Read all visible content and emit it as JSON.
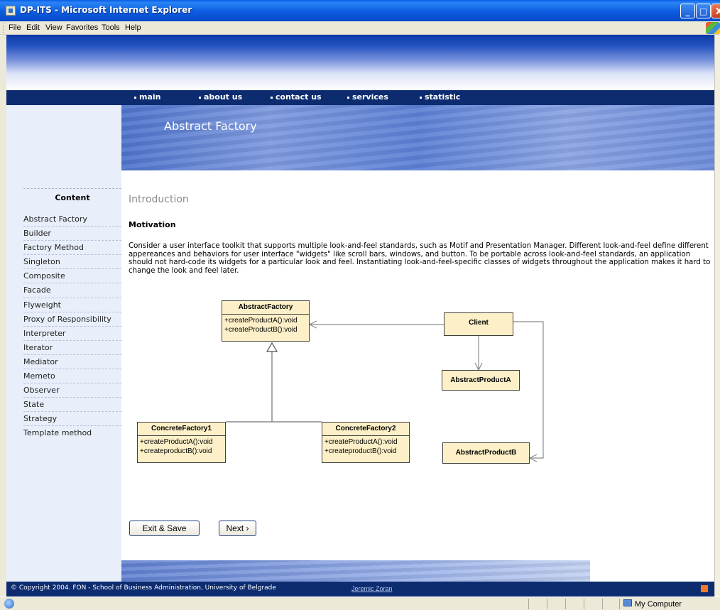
{
  "window": {
    "title": "DP-ITS - Microsoft Internet Explorer",
    "minimize": "_",
    "maximize": "□",
    "close": "X"
  },
  "menu": [
    "File",
    "Edit",
    "View",
    "Favorites",
    "Tools",
    "Help"
  ],
  "nav": [
    "main",
    "about us",
    "contact us",
    "services",
    "statistic"
  ],
  "banner": {
    "title": "Abstract Factory"
  },
  "sidebar": {
    "heading": "Content",
    "items": [
      "Abstract Factory",
      "Builder",
      "Factory Method",
      "Singleton",
      "Composite",
      "Facade",
      "Flyweight",
      "Proxy of Responsibility",
      "Interpreter",
      "Iterator",
      "Mediator",
      "Memeto",
      "Observer",
      "State",
      "Strategy",
      "Template method"
    ]
  },
  "content": {
    "section_title": "Introduction",
    "subheading": "Motivation",
    "paragraph": "Consider a user interface toolkit that supports multiple look-and-feel standards, such as Motif and Presentation Manager. Different look-and-feel define different appereances and behaviors for user interface \"widgets\" like scroll bars, windows, and button. To be portable across look-and-feel standards, an application should not hard-code its widgets for a particular look and feel. Instantiating look-and-feel-specific classes of widgets throughout the application makes it hard to change the look and feel later."
  },
  "diagram": {
    "abstract_factory": {
      "name": "AbstractFactory",
      "ops": [
        "+createProductA():void",
        "+createProductB():void"
      ]
    },
    "client": {
      "name": "Client"
    },
    "product_a": {
      "name": "AbstractProductA"
    },
    "product_b": {
      "name": "AbstractProductB"
    },
    "concrete1": {
      "name": "ConcreteFactory1",
      "ops": [
        "+createProductA():void",
        "+createproductB():void"
      ]
    },
    "concrete2": {
      "name": "ConcreteFactory2",
      "ops": [
        "+createProductA():void",
        "+createproductB():void"
      ]
    }
  },
  "buttons": {
    "exit_save": "Exit & Save",
    "next": "Next ›"
  },
  "footer": {
    "copyright": "© Copyright 2004. FON - School of Business Administration, University of Belgrade",
    "author": "Jeremic Zoran"
  },
  "status": {
    "zone": "My Computer"
  }
}
